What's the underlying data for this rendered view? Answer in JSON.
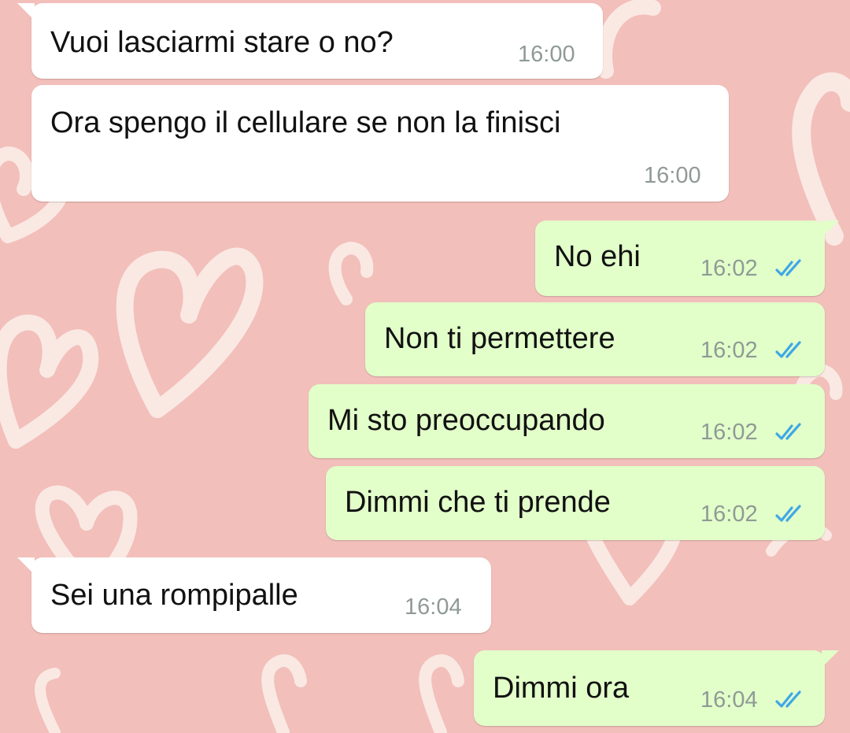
{
  "chat": {
    "messages": [
      {
        "direction": "incoming",
        "text": "Vuoi lasciarmi stare o no?",
        "time": "16:00"
      },
      {
        "direction": "incoming",
        "text": "Ora spengo il cellulare se non la finisci",
        "time": "16:00"
      },
      {
        "direction": "outgoing",
        "text": "No ehi",
        "time": "16:02",
        "status_icon": "double-check-read-icon"
      },
      {
        "direction": "outgoing",
        "text": "Non ti permettere",
        "time": "16:02",
        "status_icon": "double-check-read-icon"
      },
      {
        "direction": "outgoing",
        "text": "Mi sto preoccupando",
        "time": "16:02",
        "status_icon": "double-check-read-icon"
      },
      {
        "direction": "outgoing",
        "text": "Dimmi che ti prende",
        "time": "16:02",
        "status_icon": "double-check-read-icon"
      },
      {
        "direction": "incoming",
        "text": "Sei una rompipalle",
        "time": "16:04"
      },
      {
        "direction": "outgoing",
        "text": "Dimmi ora",
        "time": "16:04",
        "status_icon": "double-check-read-icon"
      }
    ]
  },
  "colors": {
    "wallpaper": "#f2bfba",
    "wallpaper_hearts": "#fbeeea",
    "incoming_bubble": "#ffffff",
    "outgoing_bubble": "#e2fec9",
    "read_ticks": "#3fa8e6",
    "timestamp": "#8f9a96"
  }
}
